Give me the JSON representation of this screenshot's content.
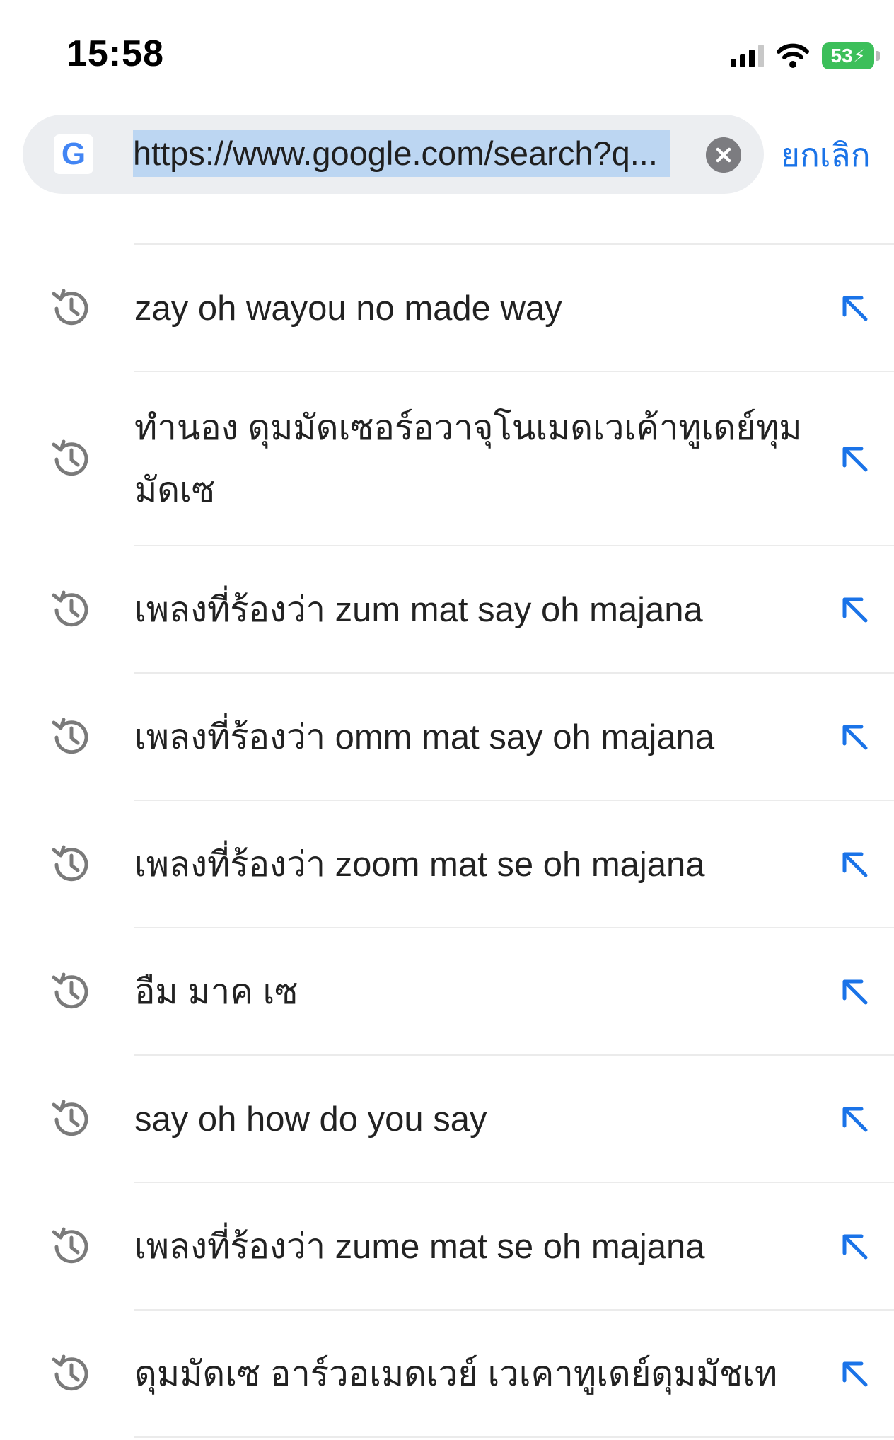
{
  "status_bar": {
    "time": "15:58",
    "battery": "53",
    "icons": [
      "cellular-signal-icon",
      "wifi-icon",
      "battery-charging-icon"
    ]
  },
  "search": {
    "url": "https://www.google.com/search?q...",
    "cancel_label": "ยกเลิก",
    "site_icon": "google-g-icon",
    "clear_icon": "clear-circle-x-icon"
  },
  "history": {
    "item_icon": "history-clock-icon",
    "action_icon": "arrow-up-left-icon",
    "items": [
      {
        "text": "zay oh wayou no made way"
      },
      {
        "text": "ทำนอง ดุมมัดเซอร์อวาจุโนเมดเวเค้าทูเดย์ทุมมัดเซ"
      },
      {
        "text": "เพลงที่ร้องว่า zum mat say oh majana"
      },
      {
        "text": "เพลงที่ร้องว่า omm mat say oh majana"
      },
      {
        "text": "เพลงที่ร้องว่า zoom mat se oh majana"
      },
      {
        "text": "อืม มาค เซ"
      },
      {
        "text": "say oh how do you say"
      },
      {
        "text": "เพลงที่ร้องว่า zume mat se oh majana"
      },
      {
        "text": "ดุมมัดเซ อาร์วอเมดเวย์ เวเคาทูเดย์ดุมมัชเท"
      }
    ]
  },
  "colors": {
    "accent": "#1a73e8",
    "url_highlight": "#bcd6f2",
    "field_bg": "#eceef1",
    "icon_gray": "#7a7a7a",
    "battery": "#3cbf5a"
  }
}
